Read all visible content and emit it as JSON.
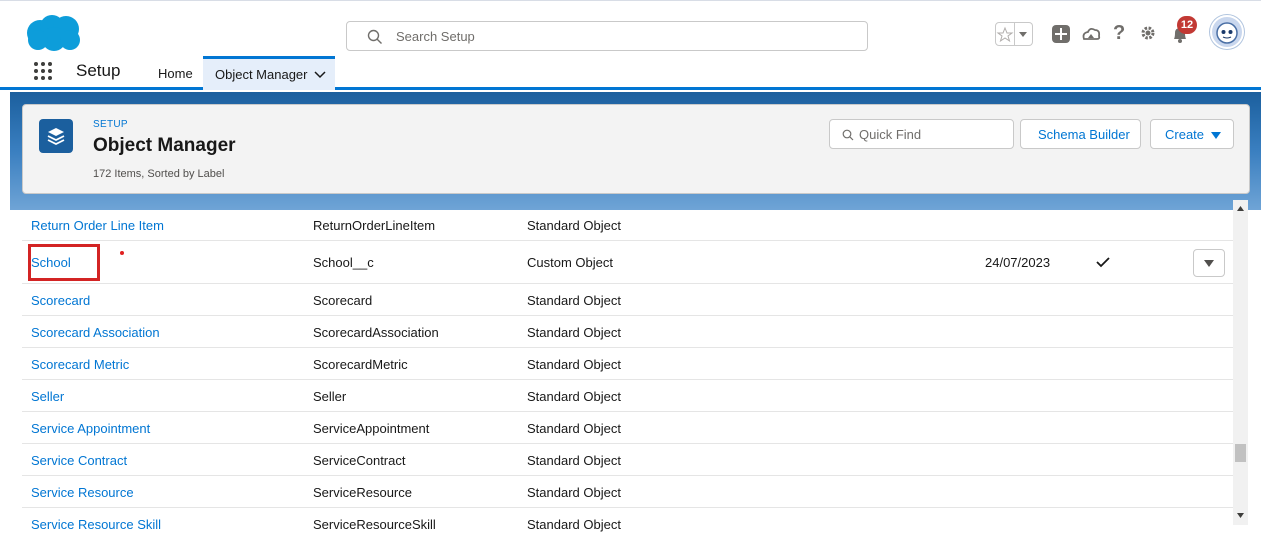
{
  "header": {
    "search_placeholder": "Search Setup",
    "notification_count": "12"
  },
  "nav": {
    "app_name": "Setup",
    "tabs": [
      {
        "label": "Home"
      },
      {
        "label": "Object Manager"
      }
    ]
  },
  "page_header": {
    "eyebrow": "SETUP",
    "title": "Object Manager",
    "meta": "172 Items, Sorted by Label",
    "quick_find_placeholder": "Quick Find",
    "schema_builder_label": "Schema Builder",
    "create_label": "Create"
  },
  "rows": [
    {
      "label": "Return Order Line Item",
      "api_name": "ReturnOrderLineItem",
      "type": "Standard Object",
      "last_modified": "",
      "deployed": false
    },
    {
      "label": "School",
      "api_name": "School__c",
      "type": "Custom Object",
      "last_modified": "24/07/2023",
      "deployed": true
    },
    {
      "label": "Scorecard",
      "api_name": "Scorecard",
      "type": "Standard Object",
      "last_modified": "",
      "deployed": false
    },
    {
      "label": "Scorecard Association",
      "api_name": "ScorecardAssociation",
      "type": "Standard Object",
      "last_modified": "",
      "deployed": false
    },
    {
      "label": "Scorecard Metric",
      "api_name": "ScorecardMetric",
      "type": "Standard Object",
      "last_modified": "",
      "deployed": false
    },
    {
      "label": "Seller",
      "api_name": "Seller",
      "type": "Standard Object",
      "last_modified": "",
      "deployed": false
    },
    {
      "label": "Service Appointment",
      "api_name": "ServiceAppointment",
      "type": "Standard Object",
      "last_modified": "",
      "deployed": false
    },
    {
      "label": "Service Contract",
      "api_name": "ServiceContract",
      "type": "Standard Object",
      "last_modified": "",
      "deployed": false
    },
    {
      "label": "Service Resource",
      "api_name": "ServiceResource",
      "type": "Standard Object",
      "last_modified": "",
      "deployed": false
    },
    {
      "label": "Service Resource Skill",
      "api_name": "ServiceResourceSkill",
      "type": "Standard Object",
      "last_modified": "",
      "deployed": false
    }
  ],
  "colors": {
    "brand_blue": "#0176d3",
    "highlight_red": "#d32424",
    "notification_red": "#c23934"
  }
}
